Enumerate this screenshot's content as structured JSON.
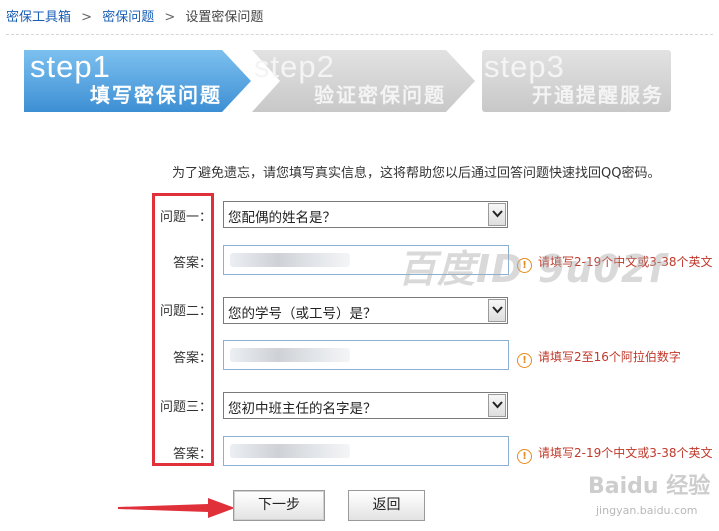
{
  "breadcrumb": {
    "item1": "密保工具箱",
    "item2": "密保问题",
    "item3": "设置密保问题",
    "separator": ">"
  },
  "steps": [
    {
      "number": "step1",
      "title": "填写密保问题",
      "state": "active",
      "color": "#4fa3e0"
    },
    {
      "number": "step2",
      "title": "验证密保问题",
      "state": "inactive",
      "color": "#d3d3d3"
    },
    {
      "number": "step3",
      "title": "开通提醒服务",
      "state": "inactive",
      "color": "#d3d3d3"
    }
  ],
  "intro": "为了避免遗忘，请您填写真实信息，这将帮助您以后通过回答问题快速找回QQ密码。",
  "form": {
    "q1_label": "问题一：",
    "q1_value": "您配偶的姓名是？",
    "a1_label": "答案：",
    "a1_hint": "请填写2-19个中文或3-38个英文",
    "q2_label": "问题二：",
    "q2_value": "您的学号（或工号）是？",
    "a2_label": "答案：",
    "a2_hint": "请填写2至16个阿拉伯数字",
    "q3_label": "问题三：",
    "q3_value": "您初中班主任的名字是？",
    "a3_label": "答案：",
    "a3_hint": "请填写2-19个中文或3-38个英文"
  },
  "hint_icon": "!",
  "buttons": {
    "next": "下一步",
    "back": "返回"
  },
  "watermark": "百度ID 9u02f",
  "brand": {
    "name": "Baidu 经验",
    "url": "jingyan.baidu.com"
  },
  "colors": {
    "highlight_box": "#e0313a",
    "hint_text": "#c0392b",
    "link": "#1a5fb4"
  }
}
